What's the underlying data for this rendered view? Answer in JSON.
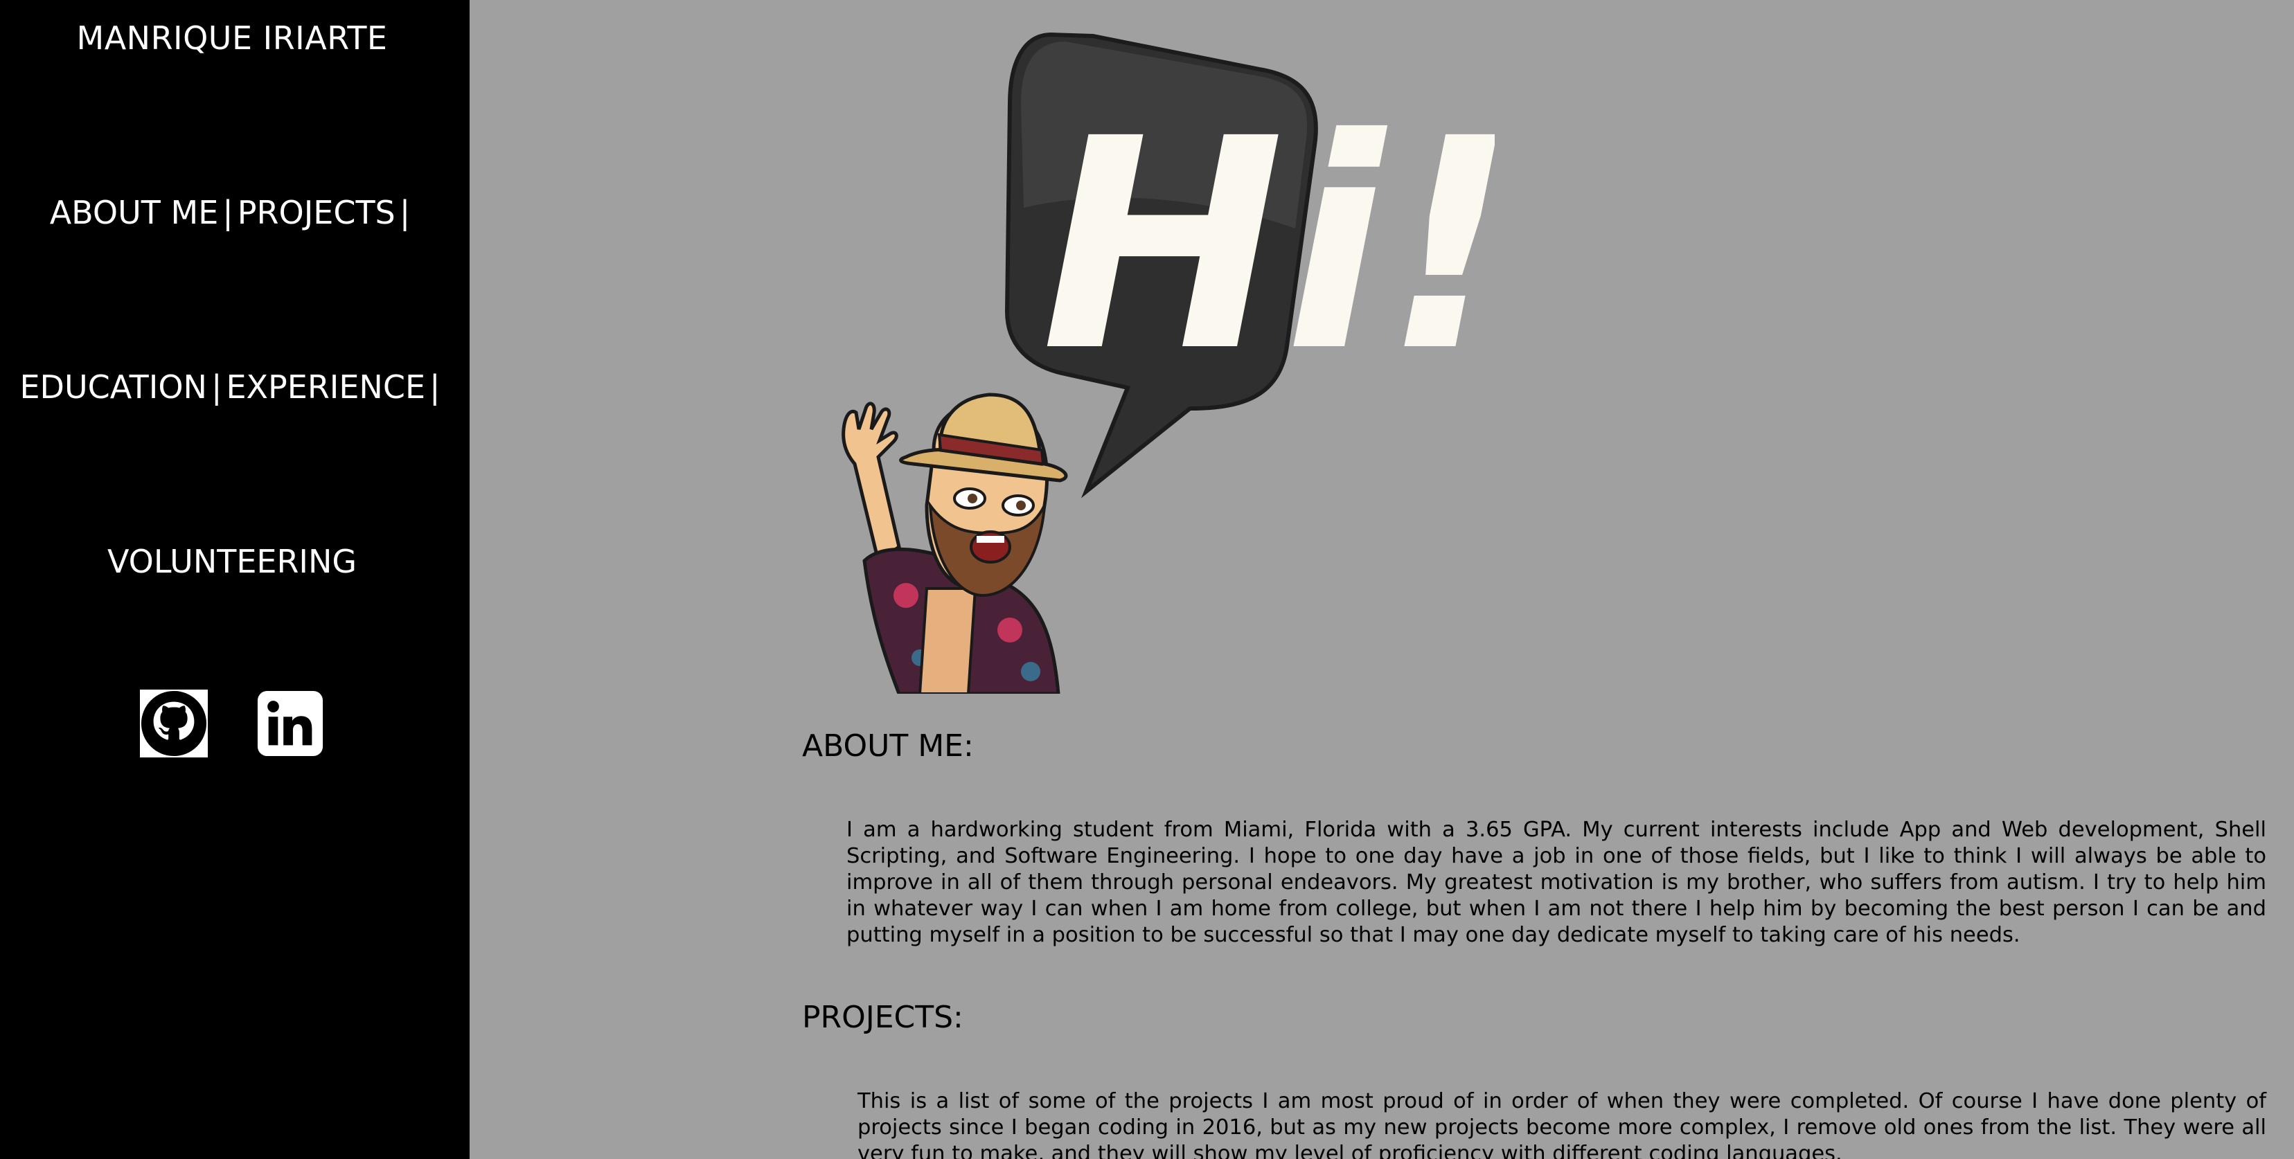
{
  "sidebar": {
    "title": "MANRIQUE IRIARTE",
    "nav": {
      "about": "ABOUT ME",
      "projects": "PROJECTS",
      "education": "EDUCATION",
      "experience": "EXPERIENCE",
      "volunteering": "VOLUNTEERING",
      "separator": "|"
    },
    "social": {
      "github_icon": "github-icon",
      "linkedin_icon": "linkedin-icon"
    }
  },
  "hero": {
    "speech_bubble_text": "Hi!"
  },
  "sections": {
    "about": {
      "title": "ABOUT ME:",
      "body": "I am a hardworking student from Miami, Florida with a 3.65 GPA. My current interests include App and Web development, Shell Scripting, and Software Engineering. I hope to one day have a job in one of those fields, but I like to think I will always be able to improve in all of them through personal endeavors. My greatest motivation is my brother, who suffers from autism. I try to help him in whatever way I can when I am home from college, but when I am not there I help him by becoming the best person I can be and putting myself in a position to be successful so that I may one day dedicate myself to taking care of his needs."
    },
    "projects": {
      "title": "PROJECTS:",
      "body": "This is a list of some of the projects I am most proud of in order of when they were completed. Of course I have done plenty of projects since I began coding in 2016, but as my new projects become more complex, I remove old ones from the list. They were all very fun to make, and they will show my level of proficiency with different coding languages."
    }
  },
  "colors": {
    "sidebar_bg": "#000000",
    "main_bg": "#a0a0a0",
    "text_light": "#ffffff",
    "text_dark": "#000000"
  }
}
